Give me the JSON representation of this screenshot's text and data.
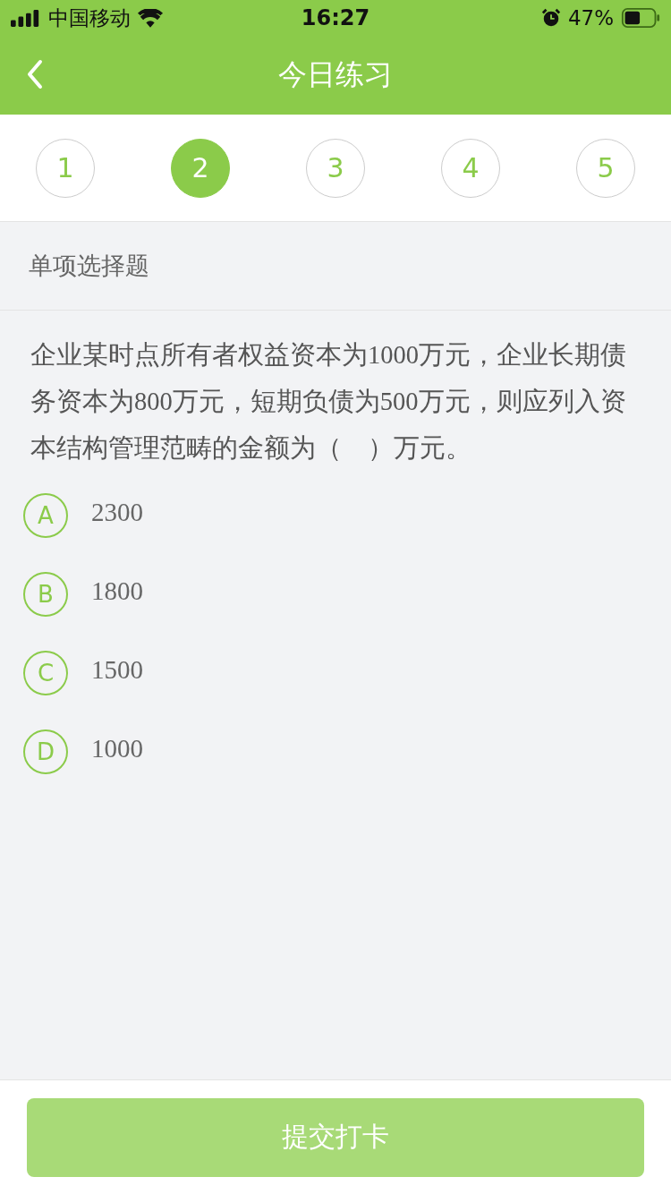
{
  "status_bar": {
    "carrier": "中国移动",
    "time": "16:27",
    "battery": "47%"
  },
  "nav": {
    "title": "今日练习"
  },
  "tabs": [
    {
      "label": "1",
      "selected": false
    },
    {
      "label": "2",
      "selected": true
    },
    {
      "label": "3",
      "selected": false
    },
    {
      "label": "4",
      "selected": false
    },
    {
      "label": "5",
      "selected": false
    }
  ],
  "section": {
    "title": "单项选择题"
  },
  "question": "企业某时点所有者权益资本为1000万元，企业长期债务资本为800万元，短期负债为500万元，则应列入资本结构管理范畴的金额为（　）万元。",
  "options": [
    {
      "letter": "A",
      "text": "2300",
      "selected": false
    },
    {
      "letter": "B",
      "text": "1800",
      "selected": false
    },
    {
      "letter": "C",
      "text": "1500",
      "selected": false
    },
    {
      "letter": "D",
      "text": "1000",
      "selected": false
    }
  ],
  "submit": {
    "label": "提交打卡",
    "disabled": true
  }
}
